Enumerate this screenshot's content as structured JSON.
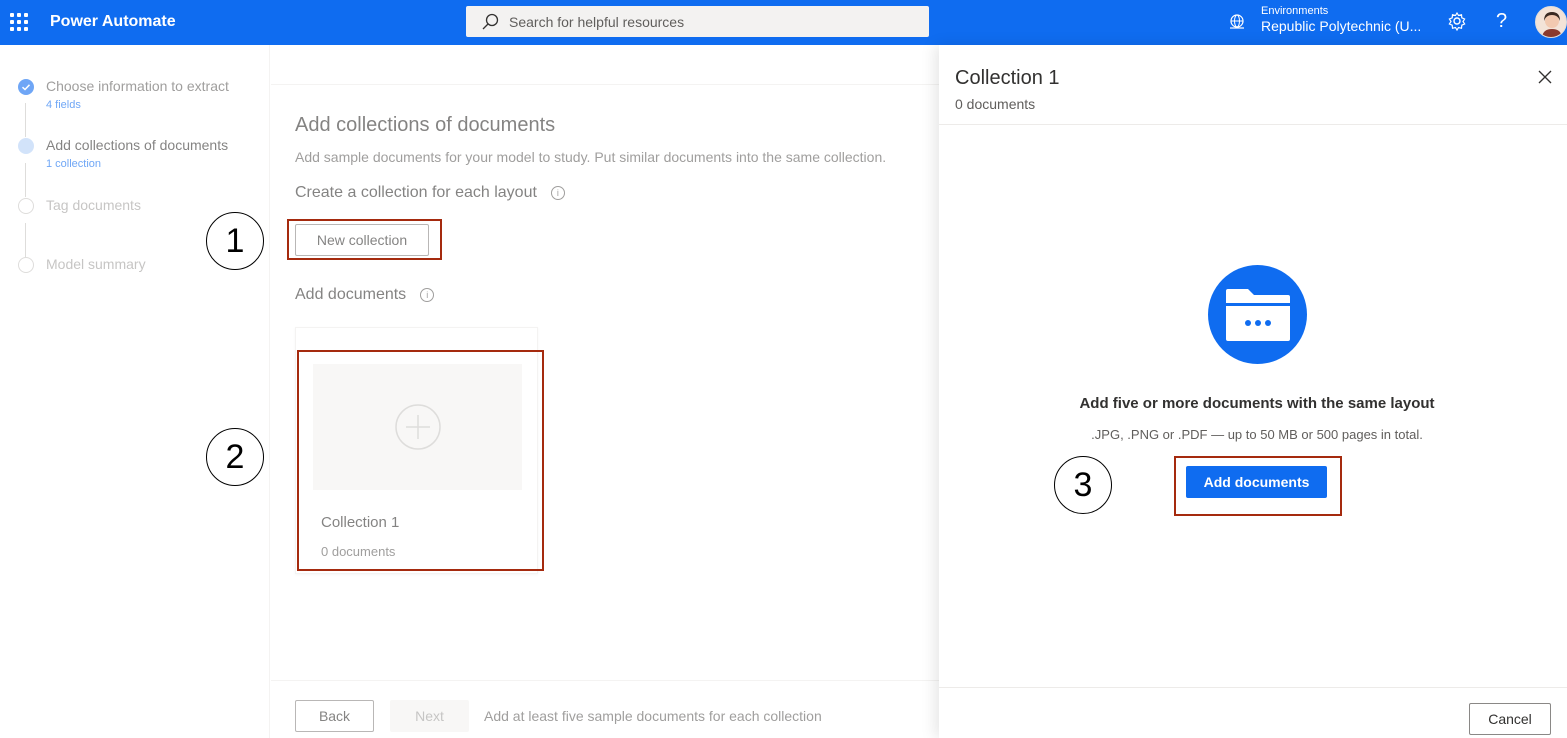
{
  "app": {
    "title": "Power Automate"
  },
  "search": {
    "placeholder": "Search for helpful resources"
  },
  "environment": {
    "label": "Environments",
    "value": "Republic Polytechnic (U..."
  },
  "colors": {
    "brand": "#0f6cf0",
    "annotation": "#a52a0e"
  },
  "icons": [
    "waffle-icon",
    "search-icon",
    "environment-icon",
    "settings-icon",
    "help-icon",
    "avatar",
    "info-icon",
    "add-circle-icon",
    "folder-icon",
    "close-icon",
    "check-icon"
  ],
  "steps": [
    {
      "label": "Choose information to extract",
      "sub": "4 fields",
      "state": "done"
    },
    {
      "label": "Add collections of documents",
      "sub": "1 collection",
      "state": "current"
    },
    {
      "label": "Tag documents",
      "sub": "",
      "state": "pending"
    },
    {
      "label": "Model summary",
      "sub": "",
      "state": "pending"
    }
  ],
  "main": {
    "title": "Add collections of documents",
    "description": "Add sample documents for your model to study. Put similar documents into the same collection.",
    "create_heading": "Create a collection for each layout",
    "new_collection_label": "New collection",
    "add_documents_heading": "Add documents",
    "card": {
      "title": "Collection 1",
      "subtitle": "0 documents"
    },
    "back_label": "Back",
    "next_label": "Next",
    "hint": "Add at least five sample documents for each collection"
  },
  "panel": {
    "title": "Collection 1",
    "subtitle": "0 documents",
    "empty_title": "Add five or more documents with the same layout",
    "empty_subtitle": ".JPG, .PNG or .PDF — up to 50 MB or 500 pages in total.",
    "add_documents_label": "Add documents",
    "cancel_label": "Cancel"
  },
  "annotations": [
    "1",
    "2",
    "3"
  ]
}
